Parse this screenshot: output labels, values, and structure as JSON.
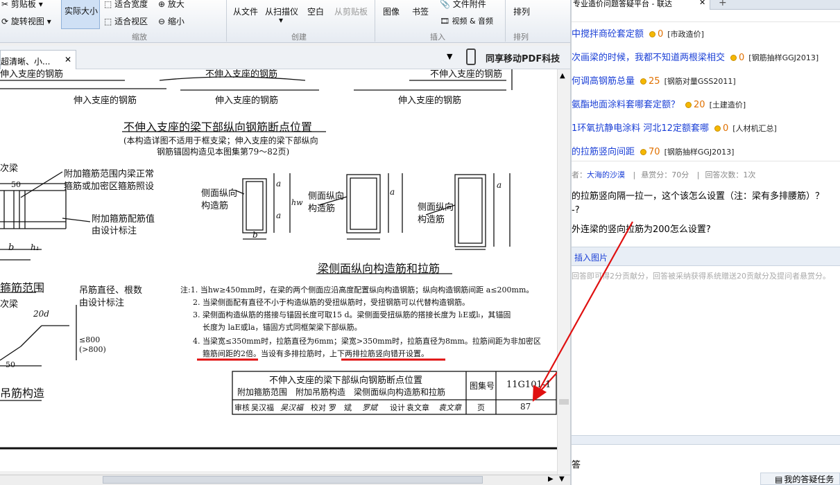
{
  "ribbon": {
    "clipboard": "剪贴板",
    "rotate": "旋转视图",
    "actual_size": "实际大小",
    "fit_width": "适合宽度",
    "fit_area": "适合视区",
    "zoom_in": "放大",
    "zoom_out": "缩小",
    "group_zoom": "缩放",
    "from_file": "从文件",
    "from_scanner": "从扫描仪",
    "blank": "空白",
    "from_clipboard": "从剪贴板",
    "group_create": "创建",
    "image": "图像",
    "bookmark": "书签",
    "attachment": "文件附件",
    "video_audio": "视频 & 音频",
    "group_insert": "插入",
    "arrange": "排列",
    "group_arrange": "排列"
  },
  "doc_tab": {
    "title": "超清晰、小...",
    "close": "✕"
  },
  "brand": "同享移动PDF科技",
  "drawing": {
    "top_labels": [
      "伸入支座的钢筋",
      "不伸入支座的钢筋",
      "不伸入支座的钢筋",
      "伸入支座的钢筋",
      "伸入支座的钢筋",
      "伸入支座的钢筋"
    ],
    "title1": "不伸入支座的梁下部纵向钢筋断点位置",
    "note1a": "(本构造详图不适用于框支梁；伸入支座的梁下部纵向",
    "note1b": "钢筋锚固构造见本图集第79～82页)",
    "left_labels": [
      "次梁",
      "50",
      "附加箍筋范围内梁正常",
      "箍筋或加密区箍筋照设",
      "附加箍筋配筋值",
      "由设计标注",
      "b",
      "h₁"
    ],
    "side_labels": [
      "侧面纵向",
      "构造筋",
      "侧面纵向",
      "构造筋",
      "侧面纵向",
      "构造筋"
    ],
    "dim_labels": [
      "a",
      "a",
      "a",
      "a",
      "hw",
      "b"
    ],
    "title2": "梁侧面纵向构造筋和拉筋",
    "range_label": "箍筋范围",
    "hanger_labels": [
      "吊筋直径、根数",
      "由设计标注",
      "次梁",
      "20d",
      "≤800",
      "(>800)",
      "50"
    ],
    "hanger_title": "吊筋构造",
    "notes": [
      "注:1. 当hw≥450mm时，在梁的两个侧面应沿高度配置纵向构造钢筋；纵向构造钢筋间距 a≤200mm。",
      "2. 当梁侧面配有直径不小于构造纵筋的受扭纵筋时，受扭钢筋可以代替构造钢筋。",
      "3. 梁侧面构造纵筋的搭接与锚固长度可取15 d。梁侧面受扭纵筋的搭接长度为 lₗE或lₗ，其锚固",
      "长度为 laE或la，锚固方式同框架梁下部纵筋。",
      "4. 当梁宽≤350mm时，拉筋直径为6mm；梁宽>350mm时，拉筋直径为8mm。拉筋间距为非加密区",
      "箍筋间距的2倍。当设有多排拉筋时，上下两排拉筋竖向错开设置。"
    ],
    "tb_title1": "不伸入支座的梁下部纵向钢筋断点位置",
    "tb_title2": "附加箍筋范围　附加吊筋构造　梁侧面纵向构造筋和拉筋",
    "tb_atlas_label": "图集号",
    "tb_atlas": "11G101-1",
    "tb_row": [
      "审核",
      "吴汉福",
      "吴汉福",
      "校对",
      "罗　斌",
      "罗斌",
      "设计",
      "袁文章",
      "袁文章",
      "页"
    ],
    "tb_page": "87"
  },
  "browser_tab": {
    "title": "专业造价问题答疑平台 - 联达",
    "close": "✕",
    "new": "+"
  },
  "questions": [
    {
      "title": "中搅拌商砼套定额",
      "points": "0",
      "cat": "[市政造价]"
    },
    {
      "title": "次画梁的时候，我都不知道两根梁相交",
      "points": "0",
      "cat": "[钢筋抽样GGJ2013]"
    },
    {
      "title": "何调高钢筋总量",
      "points": "25",
      "cat": "[钢筋对量GSS2011]"
    },
    {
      "title": "氨酯地面涂料套哪套定额？",
      "points": "20",
      "cat": "[土建造价]"
    },
    {
      "title": "1环氧抗静电涂料 河北12定额套哪",
      "points": "0",
      "cat": "[人材机汇总]"
    },
    {
      "title": "的拉筋竖向间距",
      "points": "70",
      "cat": "[钢筋抽样GGJ2013]"
    }
  ],
  "meta": {
    "asker_prefix": "者：",
    "asker": "大海的沙漠",
    "sep": "|",
    "reward": "悬赏分：70分",
    "answers": "回答次数：1次"
  },
  "question_body": [
    "的拉筋竖向隔一拉一，这个该怎么设置（注：梁有多排腰筋）？",
    "-?",
    "外连梁的竖向拉筋为200怎么设置?"
  ],
  "answer": {
    "insert_image": "插入图片",
    "hint": "回答即可得2分贡献分，回答被采纳获得系统赠送20贡献分及提问者悬赏分。"
  },
  "bottom": {
    "left_char": "答",
    "task": "我的答疑任务"
  },
  "colors": {
    "link": "#1a3fd6",
    "points": "#e07000",
    "arrow": "#e01010"
  }
}
